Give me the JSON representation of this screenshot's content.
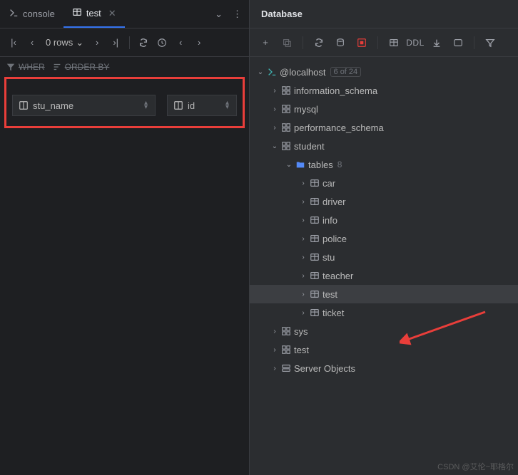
{
  "tabs": {
    "console": "console",
    "test": "test"
  },
  "toolbar": {
    "row_count": "0 rows"
  },
  "filters": {
    "where": "WHER",
    "orderby": "ORDER BY"
  },
  "columns": {
    "col1": "stu_name",
    "col2": "id"
  },
  "db": {
    "header": "Database",
    "ddl": "DDL",
    "root": "@localhost",
    "root_count": "6 of 24",
    "items": {
      "information_schema": "information_schema",
      "mysql": "mysql",
      "performance_schema": "performance_schema",
      "student": "student",
      "tables": "tables",
      "tables_count": "8",
      "car": "car",
      "driver": "driver",
      "info": "info",
      "police": "police",
      "stu": "stu",
      "teacher": "teacher",
      "test": "test",
      "ticket": "ticket",
      "sys": "sys",
      "test_db": "test",
      "server_objects": "Server Objects"
    }
  },
  "watermark": "CSDN @艾伦~耶格尔"
}
